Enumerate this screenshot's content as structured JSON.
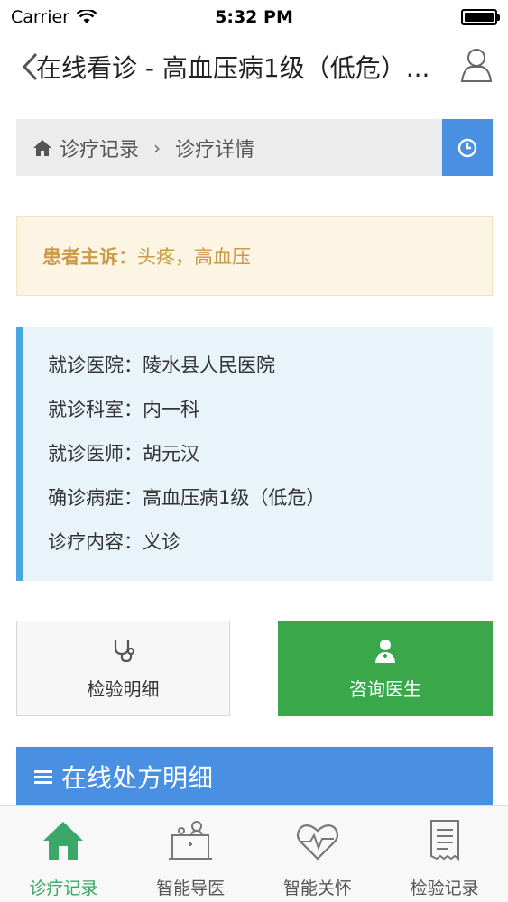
{
  "status_bar": {
    "carrier": "Carrier",
    "time": "5:32 PM"
  },
  "nav": {
    "title": "在线看诊 - 高血压病1级（低危）..."
  },
  "breadcrumb": {
    "home_label": "诊疗记录",
    "separator": "›",
    "current": "诊疗详情"
  },
  "complaint": {
    "label": "患者主诉：",
    "value": "头疼，高血压"
  },
  "info": [
    {
      "label": "就诊医院：",
      "value": "陵水县人民医院"
    },
    {
      "label": "就诊科室：",
      "value": "内一科"
    },
    {
      "label": "就诊医师：",
      "value": "胡元汉"
    },
    {
      "label": "确诊病症：",
      "value": "高血压病1级（低危）"
    },
    {
      "label": "诊疗内容：",
      "value": "义诊"
    }
  ],
  "buttons": {
    "check_detail": "检验明细",
    "consult_doctor": "咨询医生"
  },
  "prescription": {
    "title": "在线处方明细",
    "icon": "menu-icon"
  },
  "tabs": [
    {
      "label": "诊疗记录",
      "icon": "home-icon",
      "active": true
    },
    {
      "label": "智能导医",
      "icon": "guide-icon",
      "active": false
    },
    {
      "label": "智能关怀",
      "icon": "heart-icon",
      "active": false
    },
    {
      "label": "检验记录",
      "icon": "receipt-icon",
      "active": false
    }
  ],
  "colors": {
    "primary_blue": "#4a90e2",
    "green": "#3aa84a",
    "active_tab": "#3aa866",
    "warn_text": "#c99a47"
  }
}
